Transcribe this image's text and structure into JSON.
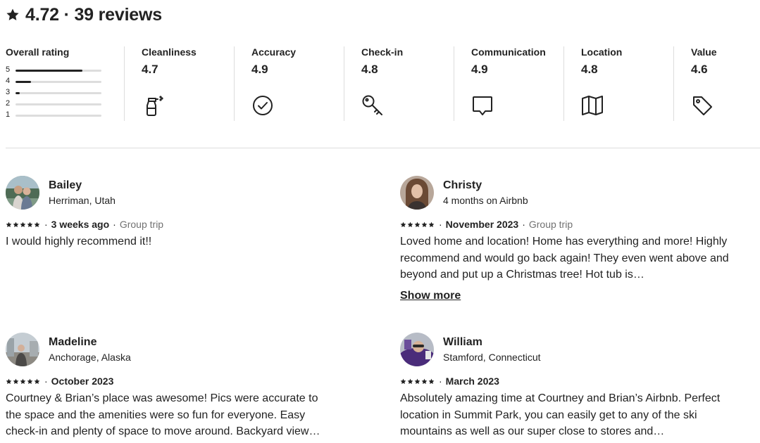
{
  "header": {
    "title": "4.72 · 39 reviews"
  },
  "overall": {
    "label": "Overall rating",
    "distribution": [
      {
        "stars": "5",
        "fraction": 0.78
      },
      {
        "stars": "4",
        "fraction": 0.18
      },
      {
        "stars": "3",
        "fraction": 0.05
      },
      {
        "stars": "2",
        "fraction": 0.0
      },
      {
        "stars": "1",
        "fraction": 0.0
      }
    ]
  },
  "categories": [
    {
      "label": "Cleanliness",
      "value": "4.7",
      "icon": "spray-bottle-icon"
    },
    {
      "label": "Accuracy",
      "value": "4.9",
      "icon": "check-circle-icon"
    },
    {
      "label": "Check-in",
      "value": "4.8",
      "icon": "key-icon"
    },
    {
      "label": "Communication",
      "value": "4.9",
      "icon": "chat-bubble-icon"
    },
    {
      "label": "Location",
      "value": "4.8",
      "icon": "map-icon"
    },
    {
      "label": "Value",
      "value": "4.6",
      "icon": "price-tag-icon"
    }
  ],
  "reviews": [
    {
      "name": "Bailey",
      "subtitle": "Herriman, Utah",
      "rating": 5,
      "date": "3 weeks ago",
      "trip": "Group trip",
      "text": "I would highly recommend it!!",
      "show_more": ""
    },
    {
      "name": "Christy",
      "subtitle": "4 months on Airbnb",
      "rating": 5,
      "date": "November 2023",
      "trip": "Group trip",
      "text": "Loved home and location! Home has everything and more! Highly recommend and would go back again! They even went above and beyond and put up a Christmas tree! Hot tub is…",
      "show_more": "Show more"
    },
    {
      "name": "Madeline",
      "subtitle": "Anchorage, Alaska",
      "rating": 5,
      "date": "October 2023",
      "trip": "",
      "text": "Courtney & Brian’s place was awesome! Pics were accurate to the space and the amenities were so fun for everyone. Easy check-in and plenty of space to move around. Backyard view…",
      "show_more": ""
    },
    {
      "name": "William",
      "subtitle": "Stamford, Connecticut",
      "rating": 5,
      "date": "March 2023",
      "trip": "",
      "text": "Absolutely amazing time at Courtney and Brian’s Airbnb. Perfect location in Summit Park, you can easily get to any of the ski mountains as well as our super close to stores and…",
      "show_more": ""
    }
  ],
  "colors": {
    "text": "#222222",
    "muted": "#717171",
    "divider": "#dddddd",
    "bar_track": "#dddddd"
  }
}
